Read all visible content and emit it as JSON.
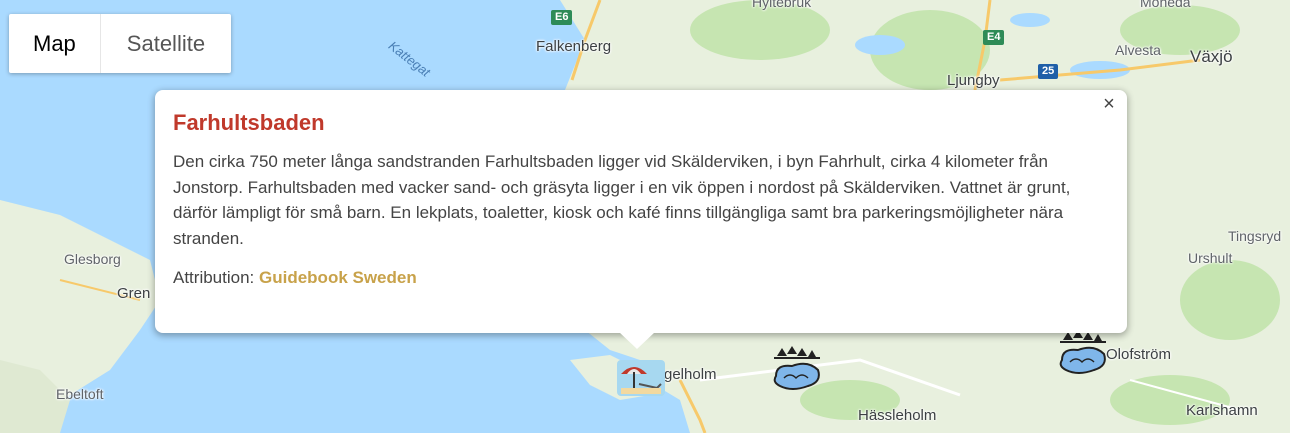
{
  "map_type": {
    "map_label": "Map",
    "satellite_label": "Satellite",
    "selected": "Map"
  },
  "places": {
    "falkenberg": "Falkenberg",
    "ljungby": "Ljungby",
    "alvesta": "Alvesta",
    "vaxjo": "Växjö",
    "glesborg": "Glesborg",
    "grenaa": "Gren",
    "ebeltoft": "Ebeltoft",
    "angelholm": "gelholm",
    "hassleholm": "Hässleholm",
    "olofstrom": "Olofström",
    "karlshamn": "Karlshamn",
    "tingsryd": "Tingsryd",
    "urshult": "Urshult",
    "hyltebruk": "Hyltebruk",
    "moheda": "Moheda",
    "kattegat": "Kattegat"
  },
  "road_shields": {
    "e6": "E6",
    "e4": "E4",
    "r25": "25"
  },
  "info_window": {
    "title": "Farhultsbaden",
    "description": "Den cirka 750 meter långa sandstranden Farhultsbaden ligger vid Skälderviken, i byn Fahrhult, cirka 4 kilometer från Jonstorp. Farhultsbaden med vacker sand- och gräsyta ligger i en vik öppen i nordost på Skälderviken. Vattnet är grunt, därför lämpligt för små barn. En lekplats, toaletter, kiosk och kafé finns tillgängliga samt bra parkeringsmöjligheter nära stranden.",
    "attribution_label": "Attribution:",
    "attribution_link": "Guidebook Sweden",
    "close_symbol": "×"
  },
  "markers": [
    {
      "name": "beach-marker",
      "icon": "umbrella-beach-icon"
    },
    {
      "name": "lake-marker-1",
      "icon": "lake-trees-icon"
    },
    {
      "name": "lake-marker-2",
      "icon": "lake-trees-icon"
    }
  ],
  "colors": {
    "land": "#e8f0de",
    "water": "#aadaff",
    "forest": "#c6e5b1",
    "title": "#c0392b",
    "attribution_link": "#c8a24a"
  }
}
